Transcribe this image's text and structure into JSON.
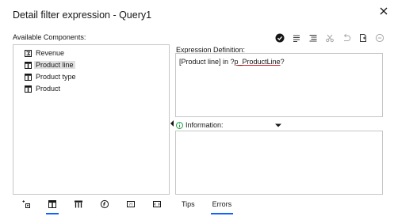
{
  "dialog": {
    "title": "Detail filter expression - Query1",
    "close_icon": "close-icon"
  },
  "available": {
    "label": "Available Components:",
    "items": [
      {
        "label": "Revenue",
        "icon": "measure-icon"
      },
      {
        "label": "Product line",
        "icon": "query-item-icon",
        "selected": true
      },
      {
        "label": "Product type",
        "icon": "query-item-icon"
      },
      {
        "label": "Product",
        "icon": "query-item-icon"
      }
    ]
  },
  "toolbar": {
    "icons": [
      "validate-icon",
      "insert-icon",
      "format-icon",
      "cut-icon",
      "undo-icon",
      "copy-icon",
      "remove-icon"
    ]
  },
  "expression": {
    "label": "Expression Definition:",
    "text_prefix": "[Product line] in ?",
    "text_param": "p_ProductLine",
    "text_suffix": "?"
  },
  "information": {
    "label": "Information:",
    "icon": "info-icon"
  },
  "bottom_tabs": {
    "icons": [
      "source-icon",
      "data-items-icon",
      "query-items-icon",
      "functions-icon",
      "parameters-icon",
      "macros-icon"
    ]
  },
  "tabs": [
    {
      "label": "Tips",
      "active": false
    },
    {
      "label": "Errors",
      "active": true
    }
  ]
}
